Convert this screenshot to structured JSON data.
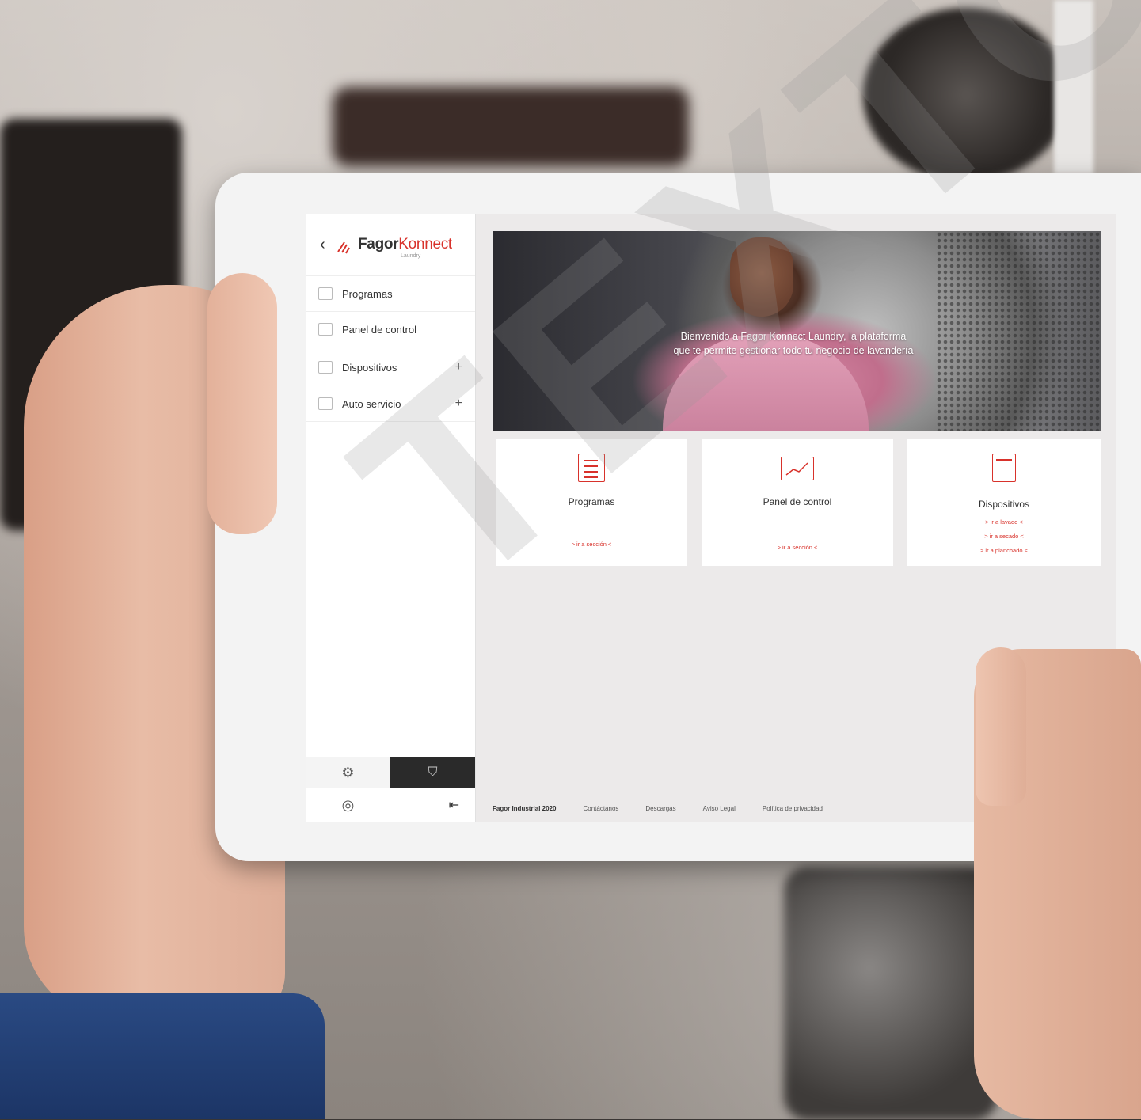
{
  "brand": {
    "name_dark": "Fagor",
    "name_red": "Konnect",
    "subtitle": "Laundry"
  },
  "sidebar": {
    "items": [
      {
        "label": "Programas",
        "expandable": false
      },
      {
        "label": "Panel de control",
        "expandable": false
      },
      {
        "label": "Dispositivos",
        "expandable": true,
        "plus": "+"
      },
      {
        "label": "Auto servicio",
        "expandable": true,
        "plus": "+"
      }
    ]
  },
  "hero": {
    "line1": "Bienvenido a Fagor Konnect Laundry, la plataforma",
    "line2": "que te permite gestionar todo tu negocio de lavandería"
  },
  "cards": [
    {
      "title": "Programas",
      "links": [
        "> ir a sección <"
      ]
    },
    {
      "title": "Panel de control",
      "links": [
        "> ir a sección <"
      ]
    },
    {
      "title": "Dispositivos",
      "links": [
        "> ir a lavado <",
        "> ir a secado <",
        "> ir a planchado <"
      ]
    }
  ],
  "footer": {
    "copyright": "Fagor Industrial 2020",
    "links": [
      "Contáctanos",
      "Descargas",
      "Aviso Legal",
      "Política de privacidad"
    ]
  },
  "watermark": "TEXTO",
  "colors": {
    "accent": "#d8322b",
    "sidebar_dark": "#2a2a2a"
  }
}
